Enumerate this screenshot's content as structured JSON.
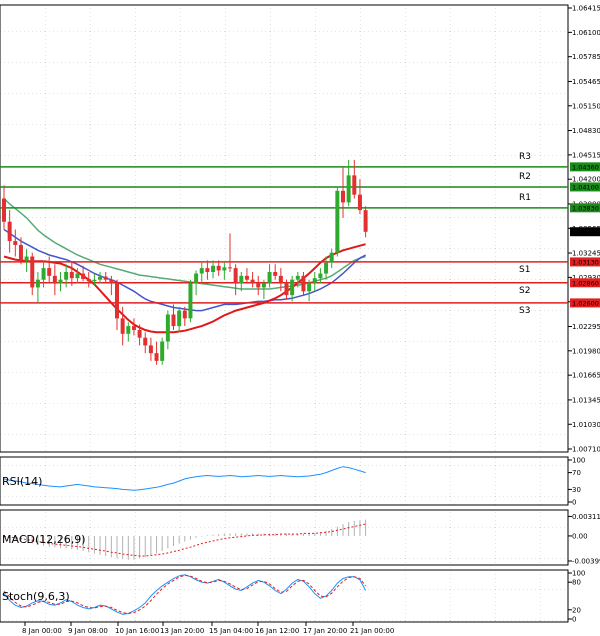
{
  "colors": {
    "bull": "#2eaa2e",
    "bear": "#e23030",
    "resistance": "#1a8a1a",
    "support": "#e02020",
    "ma_green": "#55aa77",
    "ma_blue": "#4455cc",
    "ma_red": "#e01818",
    "rsi": "#1e90ff",
    "macd_hist": "#b0b0b0",
    "macd_signal": "#e02020",
    "stoch_main": "#1e90ff",
    "stoch_signal": "#e02020",
    "price_box": "#000000",
    "grid": "#c8c8c8"
  },
  "chart_data": [
    {
      "type": "candlestick",
      "y_ticks": [
        "1.06415",
        "1.06100",
        "1.05785",
        "1.05465",
        "1.05150",
        "1.04830",
        "1.04515",
        "1.04200",
        "1.03880",
        "1.03565",
        "1.03245",
        "1.02930",
        "1.02615",
        "1.02295",
        "1.01980",
        "1.01665",
        "1.01345",
        "1.01030",
        "1.00710"
      ],
      "ylim": [
        1.0071,
        1.06415
      ],
      "x_tick_labels": [
        "8 Jan 00:00",
        "9 Jan 08:00",
        "10 Jan 16:00",
        "13 Jan 20:00",
        "15 Jan 04:00",
        "16 Jan 12:00",
        "17 Jan 20:00",
        "21 Jan 00:00"
      ],
      "last_price": "1.03521",
      "candles": [
        [
          1.0395,
          1.0412,
          1.0355,
          1.0365
        ],
        [
          1.0365,
          1.038,
          1.0325,
          1.034
        ],
        [
          1.034,
          1.0355,
          1.032,
          1.0335
        ],
        [
          1.0335,
          1.0345,
          1.031,
          1.0315
        ],
        [
          1.0315,
          1.033,
          1.03,
          1.032
        ],
        [
          1.032,
          1.0325,
          1.027,
          1.028
        ],
        [
          1.028,
          1.03,
          1.026,
          1.029
        ],
        [
          1.029,
          1.0315,
          1.028,
          1.0305
        ],
        [
          1.0305,
          1.032,
          1.0285,
          1.0295
        ],
        [
          1.0295,
          1.031,
          1.027,
          1.0285
        ],
        [
          1.0285,
          1.03,
          1.0275,
          1.029
        ],
        [
          1.029,
          1.031,
          1.028,
          1.03
        ],
        [
          1.03,
          1.0312,
          1.0282,
          1.0292
        ],
        [
          1.0292,
          1.0305,
          1.0285,
          1.0298
        ],
        [
          1.0298,
          1.0308,
          1.0288,
          1.0291
        ],
        [
          1.0291,
          1.03,
          1.028,
          1.0288
        ],
        [
          1.0288,
          1.0298,
          1.0282,
          1.029
        ],
        [
          1.029,
          1.03,
          1.0285,
          1.0294
        ],
        [
          1.0294,
          1.03,
          1.0285,
          1.029
        ],
        [
          1.029,
          1.0295,
          1.027,
          1.0285
        ],
        [
          1.0285,
          1.029,
          1.0225,
          1.024
        ],
        [
          1.024,
          1.0255,
          1.0205,
          1.022
        ],
        [
          1.022,
          1.0235,
          1.021,
          1.023
        ],
        [
          1.023,
          1.024,
          1.0218,
          1.0225
        ],
        [
          1.0225,
          1.0232,
          1.0205,
          1.0215
        ],
        [
          1.0215,
          1.0222,
          1.0195,
          1.0205
        ],
        [
          1.0205,
          1.0215,
          1.0185,
          1.0195
        ],
        [
          1.0195,
          1.021,
          1.018,
          1.0185
        ],
        [
          1.0185,
          1.0215,
          1.018,
          1.021
        ],
        [
          1.021,
          1.025,
          1.02,
          1.0245
        ],
        [
          1.0245,
          1.0258,
          1.0225,
          1.023
        ],
        [
          1.023,
          1.0255,
          1.0222,
          1.025
        ],
        [
          1.025,
          1.0255,
          1.023,
          1.024
        ],
        [
          1.024,
          1.029,
          1.0235,
          1.0285
        ],
        [
          1.0285,
          1.0302,
          1.027,
          1.0298
        ],
        [
          1.0298,
          1.0312,
          1.0285,
          1.0305
        ],
        [
          1.0305,
          1.0315,
          1.029,
          1.03
        ],
        [
          1.03,
          1.0315,
          1.0292,
          1.0308
        ],
        [
          1.0308,
          1.0315,
          1.0295,
          1.0302
        ],
        [
          1.0302,
          1.0312,
          1.029,
          1.0306
        ],
        [
          1.0306,
          1.035,
          1.03,
          1.0305
        ],
        [
          1.0305,
          1.031,
          1.027,
          1.0285
        ],
        [
          1.0285,
          1.03,
          1.0275,
          1.0295
        ],
        [
          1.0295,
          1.0305,
          1.0285,
          1.029
        ],
        [
          1.029,
          1.03,
          1.028,
          1.0285
        ],
        [
          1.0285,
          1.0295,
          1.027,
          1.028
        ],
        [
          1.028,
          1.029,
          1.0265,
          1.0285
        ],
        [
          1.0285,
          1.031,
          1.028,
          1.03
        ],
        [
          1.03,
          1.031,
          1.029,
          1.0295
        ],
        [
          1.0295,
          1.0305,
          1.0275,
          1.0285
        ],
        [
          1.0285,
          1.029,
          1.0265,
          1.027
        ],
        [
          1.027,
          1.0295,
          1.0262,
          1.029
        ],
        [
          1.029,
          1.03,
          1.028,
          1.0295
        ],
        [
          1.0295,
          1.03,
          1.027,
          1.0275
        ],
        [
          1.0275,
          1.029,
          1.0262,
          1.0286
        ],
        [
          1.0286,
          1.03,
          1.0275,
          1.0292
        ],
        [
          1.0292,
          1.0305,
          1.0285,
          1.0298
        ],
        [
          1.0298,
          1.032,
          1.029,
          1.0312
        ],
        [
          1.0312,
          1.033,
          1.0305,
          1.0325
        ],
        [
          1.0325,
          1.041,
          1.032,
          1.0405
        ],
        [
          1.0405,
          1.0435,
          1.037,
          1.039
        ],
        [
          1.039,
          1.0445,
          1.0385,
          1.0425
        ],
        [
          1.0425,
          1.0445,
          1.0395,
          1.04
        ],
        [
          1.04,
          1.042,
          1.0375,
          1.038
        ],
        [
          1.038,
          1.0385,
          1.0345,
          1.0352
        ]
      ],
      "ma_green": [
        1.0395,
        1.0388,
        1.0382,
        1.0376,
        1.037,
        1.0362,
        1.0354,
        1.0348,
        1.0343,
        1.0338,
        1.0334,
        1.033,
        1.0326,
        1.0322,
        1.0319,
        1.0316,
        1.0313,
        1.031,
        1.0308,
        1.0306,
        1.0304,
        1.0302,
        1.03,
        1.0298,
        1.0296,
        1.0295,
        1.0294,
        1.0293,
        1.0292,
        1.0291,
        1.029,
        1.0289,
        1.0288,
        1.0287,
        1.0286,
        1.0285,
        1.0284,
        1.0283,
        1.0282,
        1.0281,
        1.028,
        1.0279,
        1.0278,
        1.0278,
        1.0278,
        1.0278,
        1.0278,
        1.0278,
        1.0279,
        1.028,
        1.0281,
        1.0282,
        1.0283,
        1.0284,
        1.0286,
        1.0288,
        1.029,
        1.0292,
        1.0295,
        1.03,
        1.0305,
        1.031,
        1.0315,
        1.0318,
        1.032
      ],
      "ma_blue": [
        1.0355,
        1.035,
        1.0345,
        1.034,
        1.0336,
        1.0332,
        1.0328,
        1.0325,
        1.0322,
        1.032,
        1.0318,
        1.0316,
        1.0313,
        1.031,
        1.0306,
        1.0302,
        1.0298,
        1.0295,
        1.0292,
        1.029,
        1.0287,
        1.0283,
        1.0279,
        1.0275,
        1.027,
        1.0265,
        1.0262,
        1.026,
        1.0258,
        1.0256,
        1.0254,
        1.0253,
        1.0252,
        1.0251,
        1.025,
        1.025,
        1.0252,
        1.0254,
        1.0256,
        1.0258,
        1.0258,
        1.0258,
        1.0259,
        1.026,
        1.0261,
        1.0262,
        1.0262,
        1.0263,
        1.0264,
        1.0264,
        1.0265,
        1.0266,
        1.0268,
        1.027,
        1.0272,
        1.0275,
        1.0278,
        1.0282,
        1.0286,
        1.0292,
        1.0298,
        1.0305,
        1.0312,
        1.0318,
        1.0322
      ],
      "ma_red": [
        1.032,
        1.0318,
        1.0316,
        1.0315,
        1.0314,
        1.0314,
        1.0314,
        1.0314,
        1.0313,
        1.0312,
        1.0311,
        1.0308,
        1.0305,
        1.03,
        1.0295,
        1.029,
        1.0284,
        1.0276,
        1.0268,
        1.026,
        1.0252,
        1.0245,
        1.0238,
        1.0232,
        1.0228,
        1.0225,
        1.0223,
        1.0222,
        1.0222,
        1.0222,
        1.0222,
        1.0223,
        1.0224,
        1.0226,
        1.0228,
        1.023,
        1.0233,
        1.0236,
        1.024,
        1.0244,
        1.0247,
        1.025,
        1.0252,
        1.0254,
        1.0256,
        1.0258,
        1.026,
        1.0263,
        1.0266,
        1.027,
        1.0275,
        1.028,
        1.0286,
        1.0292,
        1.0298,
        1.0305,
        1.0312,
        1.0318,
        1.0322,
        1.0325,
        1.0328,
        1.033,
        1.0332,
        1.0334,
        1.0336
      ],
      "levels": [
        {
          "name": "R3",
          "value": 1.0436,
          "label": "1.04360",
          "kind": "resistance"
        },
        {
          "name": "R2",
          "value": 1.041,
          "label": "1.04100",
          "kind": "resistance"
        },
        {
          "name": "R1",
          "value": 1.0383,
          "label": "1.03830",
          "kind": "resistance"
        },
        {
          "name": "S1",
          "value": 1.0313,
          "label": "1.03130",
          "kind": "support"
        },
        {
          "name": "S2",
          "value": 1.0286,
          "label": "1.02860",
          "kind": "support"
        },
        {
          "name": "S3",
          "value": 1.026,
          "label": "1.02600",
          "kind": "support"
        }
      ]
    },
    {
      "type": "line",
      "title": "RSI(14)",
      "y_ticks": [
        "100",
        "70",
        "30",
        "0"
      ],
      "ylim": [
        0,
        100
      ],
      "values": [
        55,
        52,
        50,
        48,
        45,
        44,
        42,
        40,
        38,
        37,
        36,
        38,
        40,
        42,
        40,
        38,
        36,
        35,
        34,
        33,
        32,
        30,
        29,
        28,
        29,
        31,
        33,
        35,
        38,
        42,
        45,
        50,
        55,
        58,
        60,
        62,
        63,
        62,
        61,
        62,
        63,
        62,
        60,
        61,
        62,
        63,
        62,
        61,
        62,
        63,
        62,
        61,
        60,
        61,
        62,
        64,
        66,
        70,
        75,
        80,
        84,
        82,
        78,
        74,
        70
      ]
    },
    {
      "type": "bar",
      "title": "MACD(12,26,9)",
      "y_ticks": [
        "0.003113",
        "0.00",
        "-0.003997"
      ],
      "ylim": [
        -0.004,
        0.0035
      ],
      "histogram": [
        -0.0002,
        -0.0004,
        -0.0006,
        -0.0008,
        -0.001,
        -0.0012,
        -0.0014,
        -0.0016,
        -0.0017,
        -0.0018,
        -0.0019,
        -0.002,
        -0.0021,
        -0.0022,
        -0.0024,
        -0.0026,
        -0.0028,
        -0.003,
        -0.0032,
        -0.0034,
        -0.0036,
        -0.0037,
        -0.0038,
        -0.0038,
        -0.0036,
        -0.0034,
        -0.0031,
        -0.0028,
        -0.0024,
        -0.002,
        -0.0016,
        -0.0012,
        -0.0009,
        -0.0006,
        -0.0003,
        -0.0001,
        0.0001,
        0.0002,
        0.0003,
        0.0004,
        0.0004,
        0.0004,
        0.0004,
        0.0004,
        0.0004,
        0.0004,
        0.0004,
        0.0004,
        0.0004,
        0.0004,
        0.0004,
        0.0004,
        0.0004,
        0.0004,
        0.0004,
        0.0005,
        0.0006,
        0.0008,
        0.0011,
        0.0015,
        0.0019,
        0.0022,
        0.0024,
        0.0025,
        0.0026
      ],
      "signal": [
        -0.0001,
        -0.0002,
        -0.0003,
        -0.0004,
        -0.0006,
        -0.0007,
        -0.0009,
        -0.001,
        -0.0012,
        -0.0013,
        -0.0014,
        -0.0015,
        -0.0016,
        -0.0017,
        -0.0018,
        -0.002,
        -0.0021,
        -0.0023,
        -0.0024,
        -0.0026,
        -0.0027,
        -0.0029,
        -0.003,
        -0.0031,
        -0.0032,
        -0.0032,
        -0.0031,
        -0.003,
        -0.0029,
        -0.0027,
        -0.0025,
        -0.0023,
        -0.002,
        -0.0018,
        -0.0015,
        -0.0012,
        -0.001,
        -0.0008,
        -0.0006,
        -0.0004,
        -0.0003,
        -0.0002,
        -0.0001,
        0.0,
        0.0001,
        0.0001,
        0.0002,
        0.0002,
        0.0002,
        0.0003,
        0.0003,
        0.0003,
        0.0003,
        0.0004,
        0.0004,
        0.0004,
        0.0005,
        0.0006,
        0.0007,
        0.0009,
        0.0011,
        0.0013,
        0.0015,
        0.0017,
        0.0019
      ]
    },
    {
      "type": "line",
      "title": "Stoch(9,6,3)",
      "y_ticks": [
        "100",
        "80",
        "20",
        "0"
      ],
      "ylim": [
        0,
        100
      ],
      "main": [
        55,
        40,
        30,
        25,
        28,
        35,
        40,
        38,
        32,
        30,
        35,
        42,
        38,
        30,
        25,
        22,
        25,
        30,
        28,
        22,
        15,
        10,
        12,
        18,
        25,
        35,
        50,
        62,
        72,
        80,
        88,
        94,
        96,
        92,
        85,
        80,
        78,
        82,
        86,
        80,
        72,
        65,
        62,
        70,
        78,
        84,
        80,
        72,
        62,
        55,
        65,
        78,
        86,
        82,
        70,
        55,
        45,
        50,
        62,
        78,
        88,
        92,
        92,
        85,
        62
      ],
      "signal": [
        60,
        48,
        36,
        28,
        26,
        30,
        36,
        39,
        36,
        32,
        32,
        38,
        39,
        35,
        29,
        25,
        24,
        27,
        28,
        25,
        19,
        14,
        12,
        14,
        20,
        28,
        40,
        54,
        66,
        76,
        84,
        91,
        95,
        93,
        88,
        82,
        79,
        80,
        84,
        82,
        76,
        69,
        64,
        66,
        74,
        81,
        82,
        76,
        66,
        58,
        60,
        72,
        82,
        84,
        76,
        62,
        50,
        48,
        56,
        70,
        82,
        90,
        92,
        88,
        72
      ]
    }
  ]
}
